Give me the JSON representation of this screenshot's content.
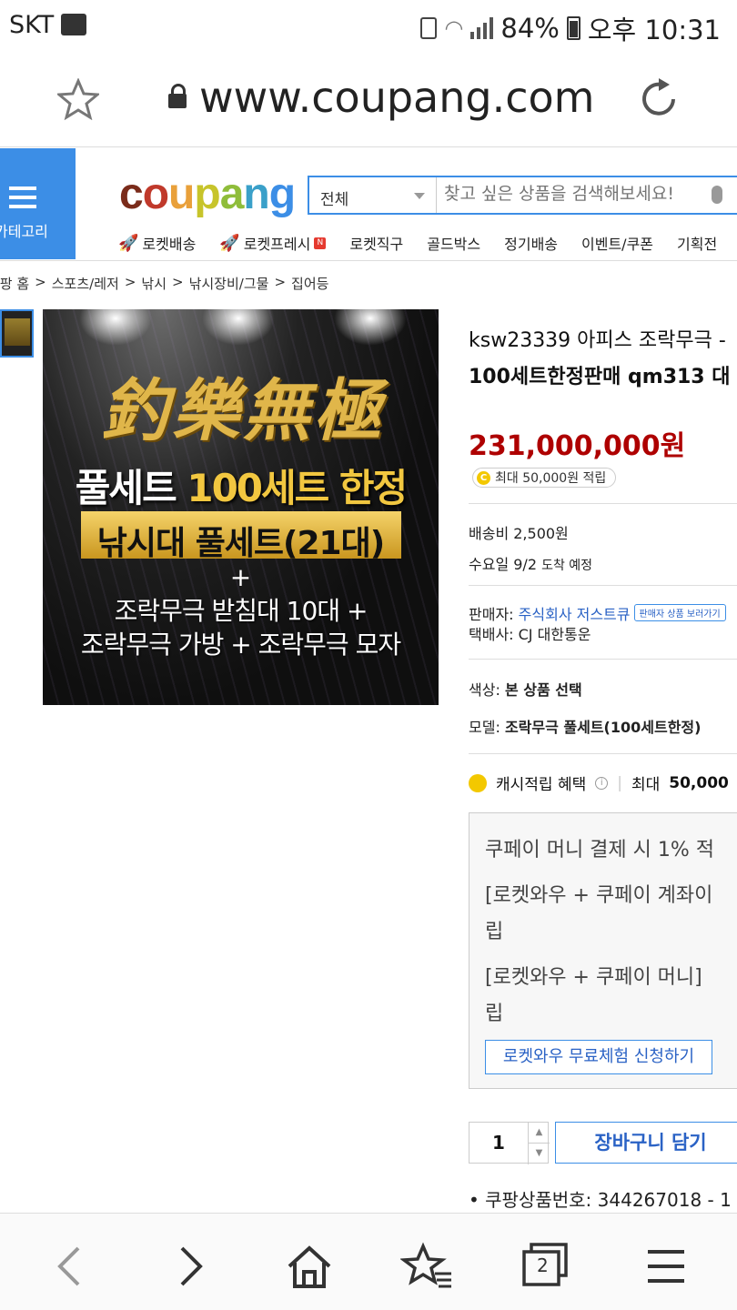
{
  "status_bar": {
    "carrier": "SKT",
    "battery": "84%",
    "time": "오후 10:31"
  },
  "browser": {
    "url": "www.coupang.com"
  },
  "header": {
    "category_label": "카테고리",
    "logo": "coupang",
    "search_scope": "전체",
    "search_placeholder": "찾고 싶은 상품을 검색해보세요!",
    "nav": [
      "로켓배송",
      "로켓프레시",
      "로켓직구",
      "골드박스",
      "정기배송",
      "이벤트/쿠폰",
      "기획전"
    ]
  },
  "breadcrumb": [
    "쿠팡 홈",
    "스포츠/레저",
    "낚시",
    "낚시장비/그물",
    "집어등"
  ],
  "product_image": {
    "calligraphy": "釣樂無極",
    "line1a": "풀세트",
    "line1b": "100세트 한정",
    "line2": "낚시대 풀세트(21대)",
    "plus": "+",
    "line3": "조락무극 받침대 10대 +",
    "line4": "조락무극 가방 + 조락무극 모자"
  },
  "product": {
    "title_line1": "ksw23339 아피스 조락무극 -",
    "title_line2": "100세트한정판매 qm313 대",
    "price": "231,000,000",
    "price_unit": "원",
    "reward_text": "최대 50,000원 적립",
    "shipping_fee": "배송비 2,500원",
    "delivery": "수요일 9/2",
    "delivery_suffix": "도착 예정",
    "seller_label": "판매자:",
    "seller_name": "주식회사 저스트큐",
    "seller_link": "판매자 상품 보러가기",
    "courier": "택배사: CJ 대한통운",
    "color_label": "색상:",
    "color_value": "본 상품 선택",
    "model_label": "모델:",
    "model_value": "조락무극 풀세트(100세트한정)"
  },
  "cash": {
    "label": "캐시적립 혜택",
    "max_label": "최대",
    "max_value": "50,000",
    "line1": "쿠페이 머니 결제 시 1% 적",
    "line2a": "[로켓와우 + 쿠페이 계좌이",
    "line2b": "립",
    "line3a": "[로켓와우 + 쿠페이 머니]",
    "line3b": "립",
    "trial_button": "로켓와우 무료체험 신청하기"
  },
  "purchase": {
    "quantity": "1",
    "cart_button": "장바구니 담기",
    "product_number": "• 쿠팡상품번호: 344267018 - 1"
  },
  "bottom_nav": {
    "tabs_count": "2",
    "icons": [
      "back-icon",
      "forward-icon",
      "home-icon",
      "bookmarks-icon",
      "tabs-icon",
      "menu-icon"
    ]
  },
  "colors": {
    "accent_blue": "#3c8ee6",
    "price_red": "#ae0000"
  }
}
